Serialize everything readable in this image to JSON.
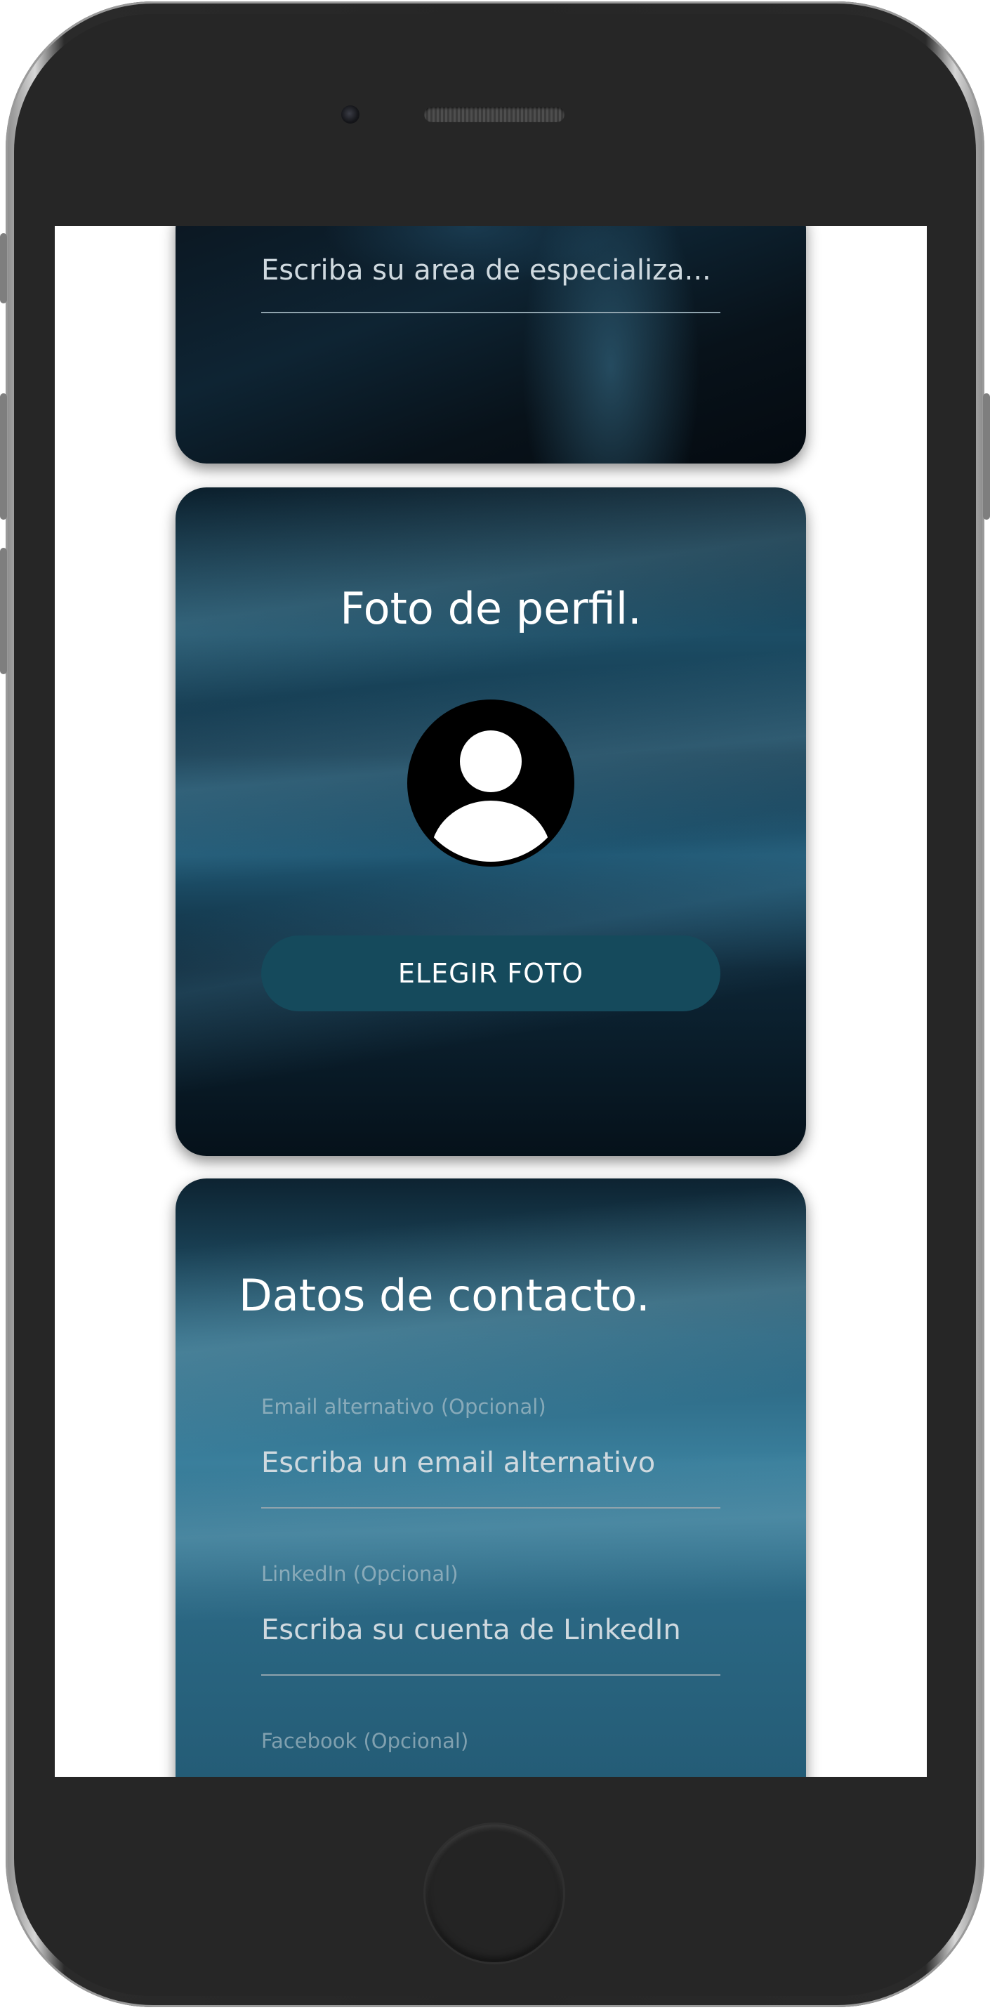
{
  "card_specialization": {
    "input_placeholder": "Escriba su area de especializa..."
  },
  "card_photo": {
    "title": "Foto de perfil.",
    "choose_button": "ELEGIR FOTO",
    "avatar_icon": "user-avatar-icon"
  },
  "card_contact": {
    "title": "Datos de contacto.",
    "fields": [
      {
        "label": "Email alternativo (Opcional)",
        "placeholder": "Escriba un email alternativo"
      },
      {
        "label": "LinkedIn (Opcional)",
        "placeholder": "Escriba su cuenta de LinkedIn"
      },
      {
        "label": "Facebook (Opcional)"
      }
    ]
  },
  "colors": {
    "button": "#154a5c",
    "card_dark": "#0a1e2b",
    "title_text": "#ffffff"
  }
}
